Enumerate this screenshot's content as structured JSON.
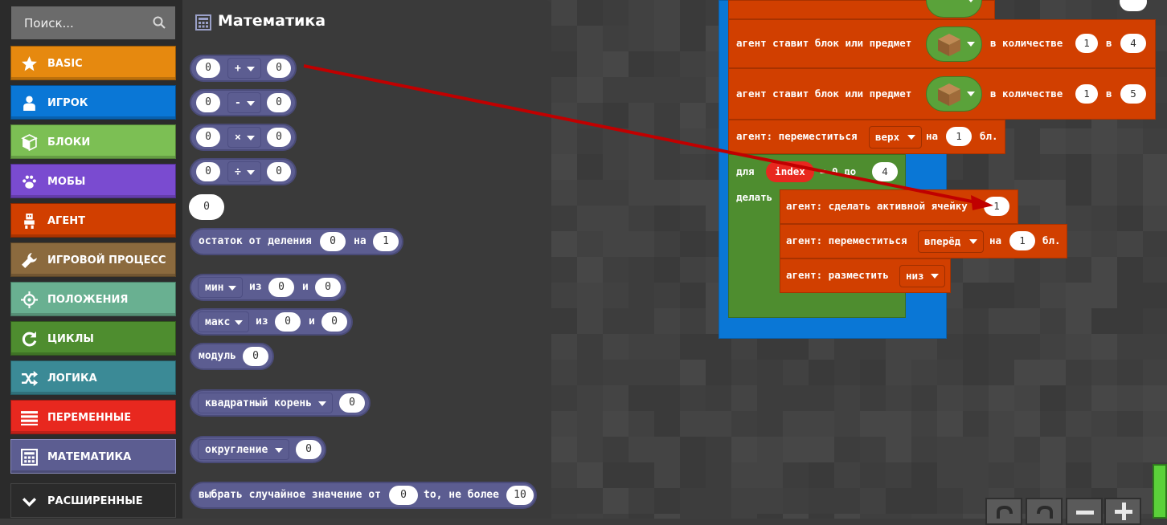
{
  "search": {
    "placeholder": "Поиск..."
  },
  "categories": [
    {
      "label": "BASIC",
      "color": "#e6890f",
      "icon": "star-icon"
    },
    {
      "label": "ИГРОК",
      "color": "#0a77d6",
      "icon": "player-icon"
    },
    {
      "label": "БЛОКИ",
      "color": "#7cbf54",
      "icon": "cube-icon"
    },
    {
      "label": "МОБЫ",
      "color": "#7a4bd0",
      "icon": "paw-icon"
    },
    {
      "label": "АГЕНТ",
      "color": "#d13f00",
      "icon": "agent-icon"
    },
    {
      "label": "ИГРОВОЙ ПРОЦЕСС",
      "color": "#8b6a3e",
      "icon": "wrench-icon"
    },
    {
      "label": "ПОЛОЖЕНИЯ",
      "color": "#69b091",
      "icon": "crosshair-icon"
    },
    {
      "label": "ЦИКЛЫ",
      "color": "#4e8d2f",
      "icon": "loop-icon"
    },
    {
      "label": "ЛОГИКА",
      "color": "#3b8a96",
      "icon": "shuffle-icon"
    },
    {
      "label": "ПЕРЕМЕННЫЕ",
      "color": "#e8281f",
      "icon": "list-icon"
    },
    {
      "label": "МАТЕМАТИКА",
      "color": "#5c5d91",
      "icon": "calculator-icon"
    },
    {
      "label": "РАСШИРЕННЫЕ",
      "color": "#2b2b2b",
      "icon": "chevron-down-icon"
    }
  ],
  "flyout": {
    "title": "Математика",
    "arith": [
      {
        "a": "0",
        "op": "+",
        "b": "0"
      },
      {
        "a": "0",
        "op": "-",
        "b": "0"
      },
      {
        "a": "0",
        "op": "×",
        "b": "0"
      },
      {
        "a": "0",
        "op": "÷",
        "b": "0"
      }
    ],
    "number": "0",
    "remainder": {
      "label": "остаток от деления",
      "a": "0",
      "on": "на",
      "b": "1"
    },
    "min": {
      "op": "мин",
      "of": "из",
      "a": "0",
      "and": "и",
      "b": "0"
    },
    "max": {
      "op": "макс",
      "of": "из",
      "a": "0",
      "and": "и",
      "b": "0"
    },
    "abs": {
      "label": "модуль",
      "a": "0"
    },
    "sqrt": {
      "op": "квадратный корень",
      "a": "0"
    },
    "round": {
      "op": "округление",
      "a": "0"
    },
    "random": {
      "label": "выбрать случайное значение от",
      "a": "0",
      "to": "to, не более",
      "b": "10"
    }
  },
  "workspace": {
    "place1": {
      "label": "агент ставит блок или предмет",
      "qty_label": "в количестве",
      "qty": "1",
      "in": "в",
      "slot": "4"
    },
    "place2": {
      "label": "агент ставит блок или предмет",
      "qty_label": "в количестве",
      "qty": "1",
      "in": "в",
      "slot": "5"
    },
    "move_up": {
      "label": "агент: переместиться",
      "dir": "верх",
      "on": "на",
      "n": "1",
      "unit": "бл."
    },
    "for_loop": {
      "for": "для",
      "var": "index",
      "from": "= 0 до",
      "to": "4",
      "do": "делать"
    },
    "set_slot": {
      "label": "агент: сделать активной ячейку",
      "n": "1"
    },
    "move_fwd": {
      "label": "агент: переместиться",
      "dir": "вперёд",
      "on": "на",
      "n": "1",
      "unit": "бл."
    },
    "place_down": {
      "label": "агент: разместить",
      "dir": "низ"
    }
  }
}
